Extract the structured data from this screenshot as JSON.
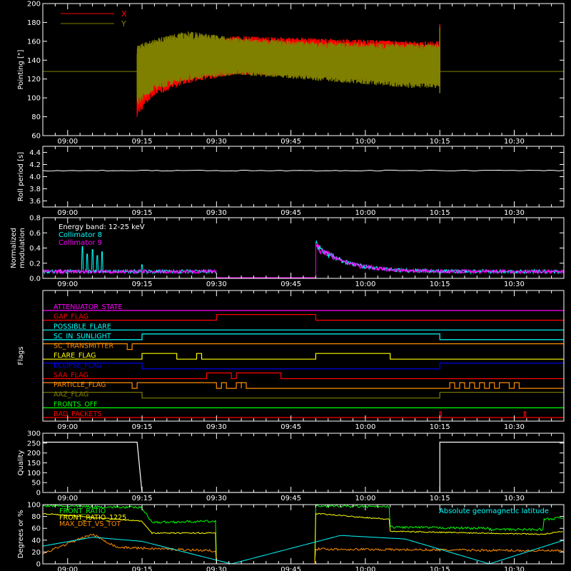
{
  "chart_data": [
    {
      "id": "pointing",
      "type": "line",
      "ylabel": "Pointing [\"]",
      "ylim": [
        60,
        200
      ],
      "yticks": [
        60,
        80,
        100,
        120,
        140,
        160,
        180,
        200
      ],
      "xlim": [
        "08:55",
        "10:40"
      ],
      "x_tick_labels": [
        "09:00",
        "09:15",
        "09:30",
        "09:45",
        "10:00",
        "10:15",
        "10:30"
      ],
      "legend": [
        {
          "name": "X",
          "color": "#ff0000"
        },
        {
          "name": "Y",
          "color": "#808000"
        }
      ],
      "baseline": 128,
      "series": [
        {
          "name": "X",
          "color": "#ff0000",
          "start": "09:14",
          "end": "10:15",
          "upper": [
            [
              0,
              150
            ],
            [
              3,
              155
            ],
            [
              10,
              162
            ],
            [
              20,
              168
            ],
            [
              35,
              166
            ],
            [
              55,
              163
            ]
          ],
          "lower": [
            [
              0,
              72
            ],
            [
              3,
              95
            ],
            [
              10,
              110
            ],
            [
              20,
              120
            ],
            [
              35,
              118
            ],
            [
              55,
              110
            ]
          ]
        },
        {
          "name": "Y",
          "color": "#808000",
          "start": "09:14",
          "end": "10:15",
          "upper": [
            [
              0,
              160
            ],
            [
              3,
              165
            ],
            [
              10,
              174
            ],
            [
              20,
              166
            ],
            [
              35,
              162
            ],
            [
              55,
              160
            ]
          ],
          "lower": [
            [
              0,
              85
            ],
            [
              3,
              100
            ],
            [
              10,
              112
            ],
            [
              20,
              120
            ],
            [
              35,
              114
            ],
            [
              55,
              105
            ]
          ]
        }
      ]
    },
    {
      "id": "roll",
      "type": "line",
      "ylabel": "Roll period [s]",
      "ylim": [
        3.5,
        4.5
      ],
      "yticks": [
        3.6,
        3.8,
        4.0,
        4.2,
        4.4
      ],
      "xlim": [
        "08:55",
        "10:40"
      ],
      "x_tick_labels": [
        "09:00",
        "09:15",
        "09:30",
        "09:45",
        "10:00",
        "10:15",
        "10:30"
      ],
      "series": [
        {
          "name": "",
          "color": "#ffffff",
          "value": 4.1
        }
      ]
    },
    {
      "id": "modulation",
      "type": "line",
      "ylabel": "Normalized modulation",
      "ylim": [
        0,
        0.8
      ],
      "yticks": [
        0.0,
        0.2,
        0.4,
        0.6,
        0.8
      ],
      "xlim": [
        "08:55",
        "10:40"
      ],
      "x_tick_labels": [
        "09:00",
        "09:15",
        "09:30",
        "09:45",
        "10:00",
        "10:15",
        "10:30"
      ],
      "legend": [
        {
          "name": "Energy band: 12-25 keV",
          "color": "#ffffff"
        },
        {
          "name": "Collimator 8",
          "color": "#00ffff"
        },
        {
          "name": "Collimator 9",
          "color": "#ff00ff"
        }
      ],
      "segments": [
        [
          "08:55",
          "09:30"
        ],
        [
          "09:50",
          "10:40"
        ]
      ],
      "level": 0.09,
      "spikes": [
        [
          "09:03",
          0.42
        ],
        [
          "09:04",
          0.32
        ],
        [
          "09:05",
          0.38
        ],
        [
          "09:06",
          0.3
        ],
        [
          "09:07",
          0.35
        ],
        [
          "09:15",
          0.18
        ]
      ],
      "decay": {
        "start": "09:50",
        "peak": 0.45,
        "tau_min": 6
      }
    },
    {
      "id": "flags",
      "type": "line",
      "ylabel": "Flags",
      "xlim": [
        "08:55",
        "10:40"
      ],
      "x_tick_labels": [
        "09:00",
        "09:15",
        "09:30",
        "09:45",
        "10:00",
        "10:15",
        "10:30"
      ],
      "flags": [
        {
          "name": "ATTENUATOR_STATE",
          "color": "#ff00ff",
          "steps": []
        },
        {
          "name": "GAP_FLAG",
          "color": "#ff0000",
          "steps": [
            [
              "09:30",
              "09:50"
            ]
          ]
        },
        {
          "name": "POSSIBLE_FLARE",
          "color": "#00ffff",
          "steps": []
        },
        {
          "name": "SC_IN_SUNLIGHT",
          "color": "#00ffff",
          "steps": [
            [
              "09:15",
              "10:15"
            ]
          ]
        },
        {
          "name": "SC_TRANSMITTER",
          "color": "#ff8c00",
          "steps": [
            [
              "08:55",
              "09:12"
            ],
            [
              "09:13",
              "10:40"
            ]
          ]
        },
        {
          "name": "FLARE_FLAG",
          "color": "#ffff00",
          "steps": [
            [
              "09:15",
              "09:22"
            ],
            [
              "09:26",
              "09:27"
            ],
            [
              "09:50",
              "10:05"
            ]
          ]
        },
        {
          "name": "ECLIPSE_FLAG",
          "color": "#0000ff",
          "steps": [
            [
              "08:55",
              "09:15"
            ],
            [
              "10:15",
              "10:40"
            ]
          ]
        },
        {
          "name": "SAA_FLAG",
          "color": "#ff0000",
          "steps": [
            [
              "09:28",
              "09:33"
            ],
            [
              "09:34",
              "09:43"
            ]
          ]
        },
        {
          "name": "PARTICLE_FLAG",
          "color": "#ff8c00",
          "steps": [
            [
              "08:55",
              "09:13"
            ],
            [
              "09:14",
              "09:30"
            ],
            [
              "09:31",
              "09:32"
            ],
            [
              "09:34",
              "09:35"
            ],
            [
              "09:35",
              "09:36"
            ],
            [
              "10:17",
              "10:18"
            ],
            [
              "10:19",
              "10:20"
            ],
            [
              "10:21",
              "10:22"
            ],
            [
              "10:23",
              "10:24"
            ],
            [
              "10:25",
              "10:26"
            ],
            [
              "10:27",
              "10:29"
            ],
            [
              "10:30",
              "10:31"
            ]
          ]
        },
        {
          "name": "AAZ_FLAG",
          "color": "#808000",
          "steps": [
            [
              "08:55",
              "09:15"
            ],
            [
              "10:15",
              "10:40"
            ]
          ]
        },
        {
          "name": "FRONTS_OFF",
          "color": "#00ff00",
          "steps": []
        },
        {
          "name": "BAD_PACKETS",
          "color": "#ff0000",
          "steps": [
            [
              "10:15",
              "10:15.3"
            ],
            [
              "10:32",
              "10:32.3"
            ]
          ]
        }
      ]
    },
    {
      "id": "quality",
      "type": "line",
      "ylabel": "Quality",
      "ylim": [
        0,
        300
      ],
      "yticks": [
        0,
        50,
        100,
        150,
        200,
        250,
        300
      ],
      "xlim": [
        "08:55",
        "10:40"
      ],
      "x_tick_labels": [
        "09:00",
        "09:15",
        "09:30",
        "09:45",
        "10:00",
        "10:15",
        "10:30"
      ],
      "series": [
        {
          "name": "",
          "color": "#ffffff",
          "points": [
            [
              "08:55",
              255
            ],
            [
              "09:14",
              255
            ],
            [
              "09:15",
              0
            ],
            [
              "10:15",
              0
            ],
            [
              "10:15",
              255
            ],
            [
              "10:40",
              255
            ]
          ]
        }
      ]
    },
    {
      "id": "degrees",
      "type": "line",
      "ylabel": "Degrees or %",
      "ylim": [
        0,
        100
      ],
      "yticks": [
        0,
        20,
        40,
        60,
        80,
        100
      ],
      "xlim": [
        "08:55",
        "10:40"
      ],
      "x_tick_labels": [
        "09:00",
        "09:15",
        "09:30",
        "09:45",
        "10:00",
        "10:15",
        "10:30"
      ],
      "legend": [
        {
          "name": "FRONT_RATIO",
          "color": "#00ff00"
        },
        {
          "name": "FRONT_RATIO_1225",
          "color": "#ffff00"
        },
        {
          "name": "MAX_DET_VS_TOT",
          "color": "#ff8c00"
        }
      ],
      "label_right": {
        "text": "Absolute geomagnetic latitude",
        "color": "#00ffff"
      },
      "series": [
        {
          "name": "FRONT_RATIO",
          "color": "#00ff00",
          "points": [
            [
              "08:55",
              98
            ],
            [
              "09:15",
              95
            ],
            [
              "09:17",
              70
            ],
            [
              "09:30",
              72
            ],
            [
              "09:30",
              0
            ],
            [
              "09:50",
              0
            ],
            [
              "09:50",
              98
            ],
            [
              "10:05",
              96
            ],
            [
              "10:05",
              62
            ],
            [
              "10:25",
              60
            ],
            [
              "10:25",
              58
            ],
            [
              "10:36",
              58
            ],
            [
              "10:36",
              75
            ],
            [
              "10:40",
              78
            ]
          ],
          "noise": 4
        },
        {
          "name": "FRONT_RATIO_1225",
          "color": "#ffff00",
          "points": [
            [
              "08:55",
              85
            ],
            [
              "09:15",
              72
            ],
            [
              "09:17",
              52
            ],
            [
              "09:30",
              52
            ],
            [
              "09:30",
              0
            ],
            [
              "09:50",
              0
            ],
            [
              "09:50",
              85
            ],
            [
              "10:05",
              75
            ],
            [
              "10:05",
              55
            ],
            [
              "10:36",
              50
            ],
            [
              "10:40",
              55
            ]
          ],
          "noise": 2
        },
        {
          "name": "MAX_DET_VS_TOT",
          "color": "#ff8c00",
          "points": [
            [
              "08:55",
              18
            ],
            [
              "09:05",
              50
            ],
            [
              "09:10",
              28
            ],
            [
              "09:30",
              22
            ],
            [
              "09:30",
              0
            ],
            [
              "09:50",
              0
            ],
            [
              "09:50",
              25
            ],
            [
              "10:40",
              22
            ]
          ],
          "noise": 4
        },
        {
          "name": "Absolute geomagnetic latitude",
          "color": "#00ffff",
          "points": [
            [
              "08:55",
              30
            ],
            [
              "09:05",
              45
            ],
            [
              "09:15",
              38
            ],
            [
              "09:33",
              0
            ],
            [
              "09:55",
              48
            ],
            [
              "10:08",
              42
            ],
            [
              "10:25",
              0
            ],
            [
              "10:40",
              40
            ]
          ],
          "noise": 0
        }
      ]
    }
  ]
}
